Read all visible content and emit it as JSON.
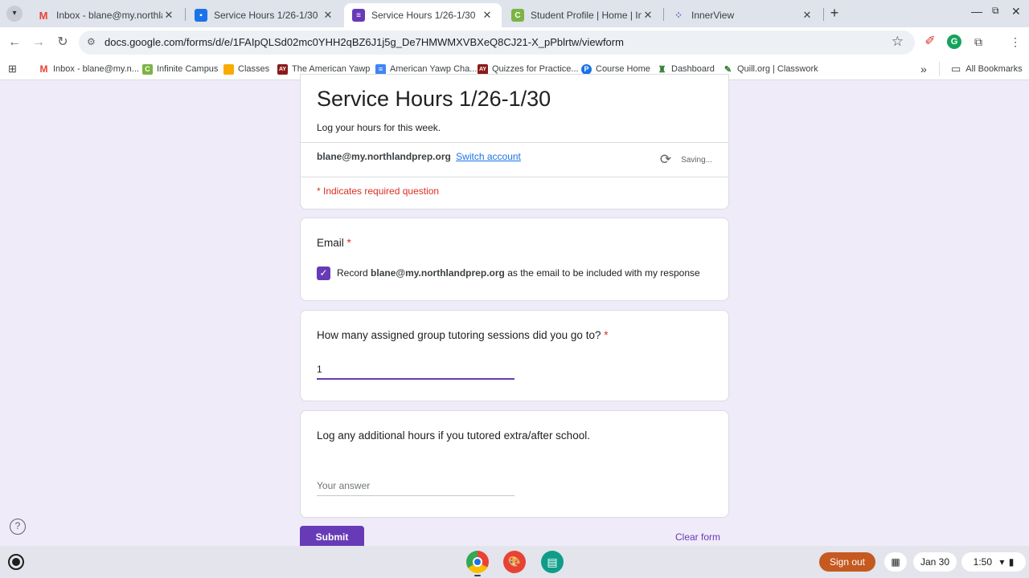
{
  "browser": {
    "tabs": [
      {
        "title": "Inbox - blane@my.northlandpre",
        "icon": "gmail-icon",
        "color": "#ea4335"
      },
      {
        "title": "Service Hours 1/26-1/30",
        "icon": "classroom-icon",
        "color": "#1a73e8"
      },
      {
        "title": "Service Hours 1/26-1/30",
        "icon": "forms-icon",
        "color": "#673ab7"
      },
      {
        "title": "Student Profile | Home | Infinite",
        "icon": "infinite-campus-icon",
        "color": "#7cb342"
      },
      {
        "title": "InnerView",
        "icon": "innerview-icon",
        "color": "#7e57c2"
      }
    ],
    "new_tab_label": "+",
    "url_host": "docs.google.com",
    "url_path": "/forms/d/e/1FAIpQLSd02mc0YHH2qBZ6J1j5g_De7HMWMXVBXeQ8CJ21-X_pPblrtw/viewform",
    "bookmarks": [
      {
        "label": "Inbox - blane@my.n...",
        "color": "#ea4335",
        "glyph": "M"
      },
      {
        "label": "Infinite Campus",
        "color": "#7cb342",
        "glyph": "C"
      },
      {
        "label": "Classes",
        "color": "#f9ab00",
        "glyph": ""
      },
      {
        "label": "The American Yawp",
        "color": "#8b1a1a",
        "glyph": "AY"
      },
      {
        "label": "American Yawp Cha...",
        "color": "#4285f4",
        "glyph": "≡"
      },
      {
        "label": "Quizzes for Practice...",
        "color": "#8b1a1a",
        "glyph": "AY"
      },
      {
        "label": "Course Home",
        "color": "#1a73e8",
        "glyph": "P"
      },
      {
        "label": "Dashboard",
        "color": "#2e7d32",
        "glyph": "♜"
      },
      {
        "label": "Quill.org | Classwork",
        "color": "#2e7d32",
        "glyph": "✎"
      }
    ],
    "overflow_label": "»",
    "all_bookmarks_label": "All Bookmarks"
  },
  "form": {
    "title": "Service Hours 1/26-1/30",
    "description": "Log your hours for this week.",
    "account_email": "blane@my.northlandprep.org",
    "switch_account_label": "Switch account",
    "saving_status": "Saving...",
    "required_note": "* Indicates required question",
    "email_question": {
      "label": "Email",
      "required_star": "*",
      "checkbox_prefix": "Record",
      "checkbox_email": "blane@my.northlandprep.org",
      "checkbox_suffix": "as the email to be included with my response",
      "checked": true
    },
    "q1": {
      "label": "How many assigned group tutoring sessions did you go to?",
      "required_star": "*",
      "value": "1"
    },
    "q2": {
      "label": "Log any additional hours if you tutored extra/after school.",
      "placeholder": "Your answer"
    },
    "submit_label": "Submit",
    "clear_label": "Clear form",
    "accent_color": "#673ab7"
  },
  "shelf": {
    "sign_out_label": "Sign out",
    "date": "Jan 30",
    "time": "1:50",
    "sign_out_color": "#c5591f"
  }
}
